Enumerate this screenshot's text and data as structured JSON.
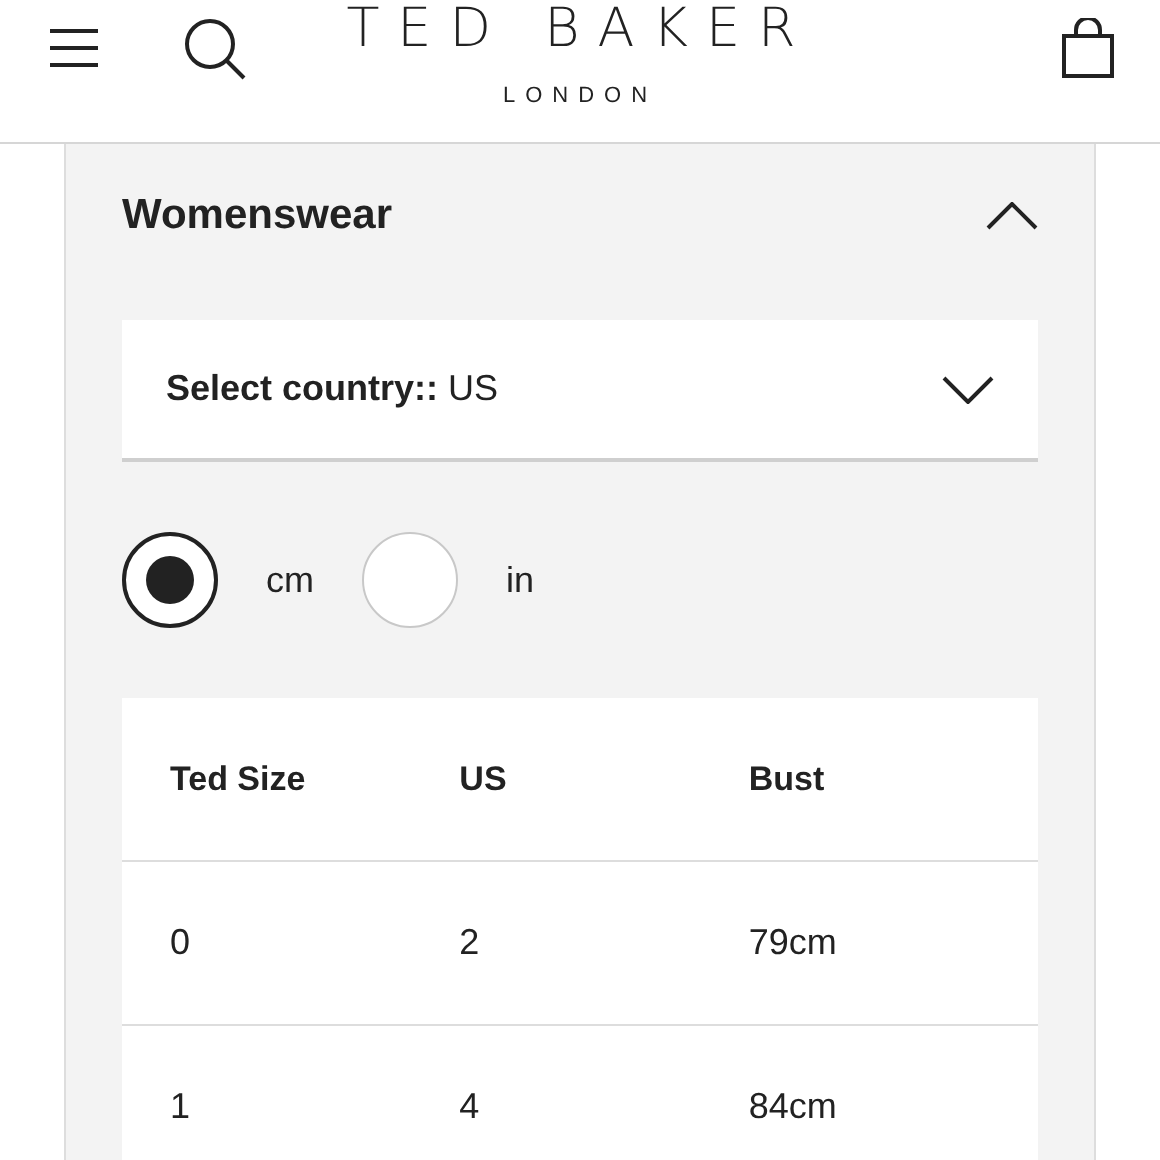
{
  "header": {
    "brand": "TED BAKER",
    "subbrand": "LONDON"
  },
  "section": {
    "title": "Womenswear",
    "expanded": true
  },
  "country_select": {
    "text": "**Select country::** US"
  },
  "units": [
    {
      "label": "cm",
      "selected": true
    },
    {
      "label": "in",
      "selected": false
    }
  ],
  "table": {
    "columns": [
      "Ted Size",
      "US",
      "Bust"
    ],
    "rows": [
      [
        "0",
        "2",
        "79cm"
      ],
      [
        "1",
        "4",
        "84cm"
      ]
    ]
  }
}
